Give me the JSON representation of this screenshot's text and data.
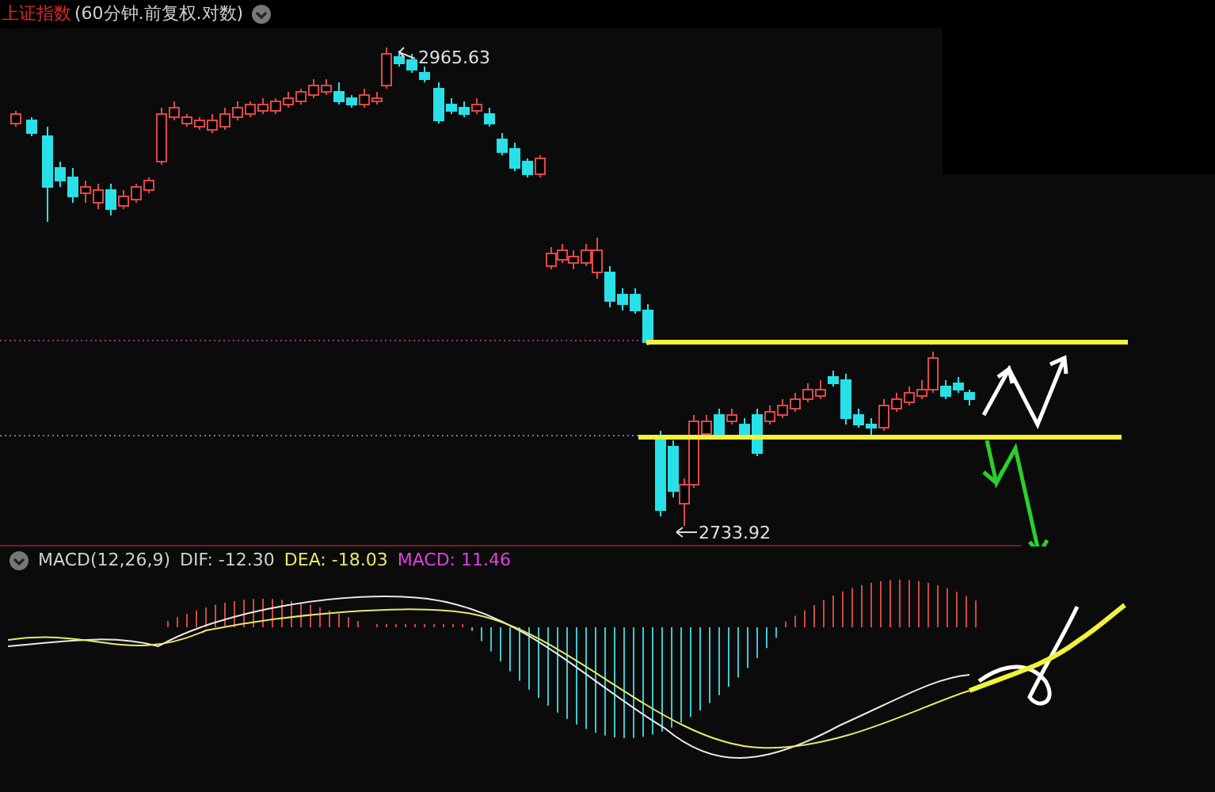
{
  "header": {
    "title": "上证指数",
    "params": "(60分钟.前复权.对数)"
  },
  "price_chart": {
    "high_label": "2965.63",
    "low_label": "2733.92"
  },
  "macd_panel": {
    "name": "MACD(12,26,9)",
    "dif": "DIF: -12.30",
    "dea": "DEA: -18.03",
    "macd": "MACD: 11.46"
  }
}
